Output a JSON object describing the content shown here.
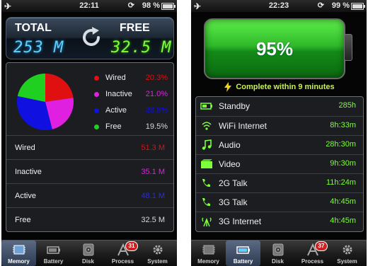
{
  "colors": {
    "wired": "#e01010",
    "inactive": "#e020e0",
    "active": "#1010e0",
    "free": "#20d020",
    "free_text": "#d8d8d8",
    "accent_green": "#7dff3a",
    "accent_blue": "#5fd0ff"
  },
  "left": {
    "status": {
      "time": "22:11",
      "battery_pct": "98 %",
      "battery_fill": 0.98
    },
    "header": {
      "total_label": "TOTAL",
      "total_value": "253 M",
      "free_label": "FREE",
      "free_value": "32.5 M"
    },
    "chart_data": {
      "type": "pie",
      "categories": [
        "Wired",
        "Inactive",
        "Active",
        "Free"
      ],
      "values": [
        20.3,
        21.0,
        28.8,
        19.5
      ],
      "value_labels": [
        "20.3%",
        "21.0%",
        "28.8%",
        "19.5%"
      ],
      "colors": [
        "#e01010",
        "#e020e0",
        "#1010e0",
        "#20d020"
      ]
    },
    "rows": [
      {
        "name": "Wired",
        "value": "51.3 M",
        "color": "#e01010"
      },
      {
        "name": "Inactive",
        "value": "35.1 M",
        "color": "#e020e0"
      },
      {
        "name": "Active",
        "value": "48.1 M",
        "color": "#2a2ae6"
      },
      {
        "name": "Free",
        "value": "32.5 M",
        "color": "#d8d8d8"
      }
    ],
    "tabs": [
      {
        "label": "Memory",
        "icon": "memory-chip-icon",
        "active": true
      },
      {
        "label": "Battery",
        "icon": "battery-icon",
        "active": false
      },
      {
        "label": "Disk",
        "icon": "disk-icon",
        "active": false
      },
      {
        "label": "Process",
        "icon": "process-icon",
        "active": false,
        "badge": "31"
      },
      {
        "label": "System",
        "icon": "gear-icon",
        "active": false
      }
    ]
  },
  "right": {
    "status": {
      "time": "22:23",
      "battery_pct": "99 %",
      "battery_fill": 0.99
    },
    "battery": {
      "percent": "95%",
      "level": 0.95,
      "charge_text": "Complete within 9 minutes"
    },
    "usage": [
      {
        "name": "Standby",
        "value": "285h",
        "icon": "standby-icon"
      },
      {
        "name": "WiFi Internet",
        "value": "8h:33m",
        "icon": "wifi-icon"
      },
      {
        "name": "Audio",
        "value": "28h:30m",
        "icon": "music-note-icon"
      },
      {
        "name": "Video",
        "value": "9h:30m",
        "icon": "video-icon"
      },
      {
        "name": "2G Talk",
        "value": "11h:24m",
        "icon": "phone-2g-icon"
      },
      {
        "name": "3G Talk",
        "value": "4h:45m",
        "icon": "phone-3g-icon"
      },
      {
        "name": "3G Internet",
        "value": "4h:45m",
        "icon": "antenna-3g-icon"
      }
    ],
    "tabs": [
      {
        "label": "Memory",
        "icon": "memory-chip-icon",
        "active": false
      },
      {
        "label": "Battery",
        "icon": "battery-icon",
        "active": true
      },
      {
        "label": "Disk",
        "icon": "disk-icon",
        "active": false
      },
      {
        "label": "Process",
        "icon": "process-icon",
        "active": false,
        "badge": "37"
      },
      {
        "label": "System",
        "icon": "gear-icon",
        "active": false
      }
    ]
  }
}
